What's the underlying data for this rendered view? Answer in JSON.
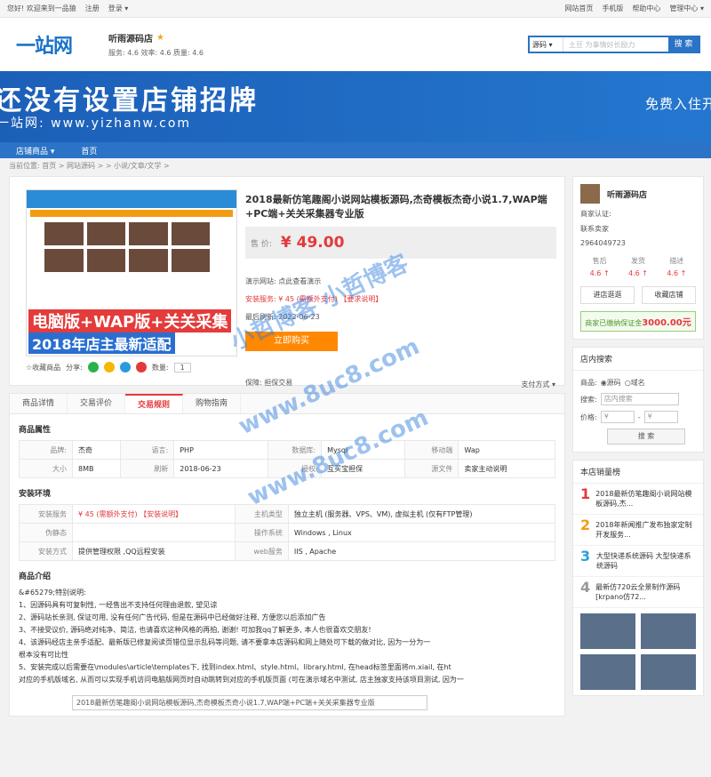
{
  "topbar": {
    "welcome": "您好! 欢迎来到一品猿",
    "register": "注册",
    "login": "登录 ▾",
    "links": [
      "网站首页",
      "手机版",
      "帮助中心",
      "管理中心 ▾"
    ]
  },
  "header": {
    "logo": "一站网",
    "shop_name": "听雨源码店",
    "scores": "服务: 4.6  效率: 4.6  质量: 4.6",
    "search_type": "源码 ▾",
    "search_placeholder": "土豆  为事情好长励力",
    "search_button": "搜 索"
  },
  "banner": {
    "line1": "还没有设置店铺招牌",
    "line2": "一站网: www.yizhanw.com",
    "line3": "免费入住开"
  },
  "nav": {
    "items": [
      "店铺商品 ▾",
      "首页"
    ]
  },
  "breadcrumb": "当前位置: 首页 > 网站源码 > > 小说/文章/文学 >",
  "product": {
    "image_cap1": "电脑版+WAP版+关关采集",
    "image_cap2": "2018年店主最新适配",
    "title": "2018最新仿笔趣阁小说网站模板源码,杰奇模板杰奇小说1.7,WAP端+PC端+关关采集器专业版",
    "price_label": "售 价:",
    "price": "¥ 49.00",
    "demo": "演示网站: 点此查看演示",
    "install": "安装服务: ¥ 45 (需额外支付) 【要求说明】",
    "updated": "最后刷新: 2022-06-23",
    "buy": "立即购买",
    "guarantee": "保障: 担保交易",
    "favorite": "☆收藏商品",
    "share": "分享:",
    "qty_label": "数量:",
    "qty": "1",
    "paymode": "支付方式 ▾"
  },
  "tabs": [
    "商品详情",
    "交易评价",
    "交易规则",
    "购物指南"
  ],
  "attrs": {
    "title": "商品属性",
    "rows": [
      [
        "品牌:",
        "杰奇",
        "语言:",
        "PHP",
        "数据库:",
        "Mysql",
        "移动端",
        "Wap"
      ],
      [
        "大小",
        "8MB",
        "刷新",
        "2018-06-23",
        "授权",
        "互买宝担保",
        "源文件",
        "卖家主动说明"
      ]
    ]
  },
  "env": {
    "title": "安装环境",
    "rows": [
      [
        "安装服务",
        "¥ 45 (需额外支付) 【安装说明】",
        "主机类型",
        "独立主机 (服务器、VPS、VM), 虚拟主机 (仅有FTP管理)"
      ],
      [
        "伪静态",
        "",
        "操作系统",
        "Windows , Linux"
      ],
      [
        "安装方式",
        "提供管理权限 ,QQ远程安装",
        "web服务",
        "IIS , Apache"
      ]
    ]
  },
  "intro": {
    "title": "商品介绍",
    "lines": [
      "&#65279;特别说明:",
      "1、因源码具有可复制性, 一经售出不支持任何理由退款, 望见谅",
      "2、源码站长亲测, 保证可用, 没有任何广告代码, 但是在源码中已经做好注释, 方便您以后添加广告",
      "3、不接受议价, 源码绝对纯净、简洁, 也请喜欢这种风格的再拍, 谢谢! 可加我qq了解更多, 本人也很喜欢交朋友!",
      "4、该源码经店主亲手适配、最新版已修复阅读页错位显示乱码等问题, 请不要拿本店源码和网上随处可下载的做对比, 因为一分为一",
      "根本没有可比性",
      "5、安装完成以后需要在\\modules\\article\\templates下, 找到index.html、style.html、library.html, 在head标签里面将m.xiail, 在ht",
      "对应的手机版域名, 从而可以实现手机访问电脑版网页时自动跳转到对应的手机版页面 (可在演示域名中测试, 店主独家支持该项目测试, 因为一"
    ],
    "image_caption": "2018最新仿笔趣阁小说网站模板源码,杰奇模板杰奇小说1.7,WAP端+PC端+关关采集器专业版"
  },
  "side": {
    "shop_name": "听雨源码店",
    "verify": "商家认证:",
    "contact": "联系卖家",
    "qq": "2964049723",
    "score_labels": [
      "售后",
      "发货",
      "描述"
    ],
    "score_values": [
      "4.6 ↑",
      "4.6 ↑",
      "4.6 ↑"
    ],
    "btn_shop": "进店逛逛",
    "btn_fav": "收藏店铺",
    "deposit": "商家已缴纳保证金",
    "deposit_amt": "3000.00元"
  },
  "shopsearch": {
    "title": "店内搜索",
    "goods": "商品:",
    "opt1": "◉源码",
    "opt2": "○域名",
    "kw": "搜索:",
    "kw_ph": "店内搜索",
    "price": "价格:",
    "p1": "¥",
    "p2": "¥",
    "btn": "搜 索"
  },
  "ranking": {
    "title": "本店销量榜",
    "items": [
      {
        "n": "1",
        "t": "2018最新仿笔趣阁小说网站模板源码,杰..."
      },
      {
        "n": "2",
        "t": "2018年新闻推广发布独家定制开发服务..."
      },
      {
        "n": "3",
        "t": "大型快递系统源码 大型快递系统源码"
      },
      {
        "n": "4",
        "t": "最新仿720云全景制作源码[krpano仿72..."
      }
    ],
    "colors": [
      "#e4393c",
      "#f39c12",
      "#2aa0d8",
      "#999999"
    ]
  },
  "watermark": {
    "w1": "小哲博客 小哲博客",
    "w2": "www.8uc8.com"
  }
}
